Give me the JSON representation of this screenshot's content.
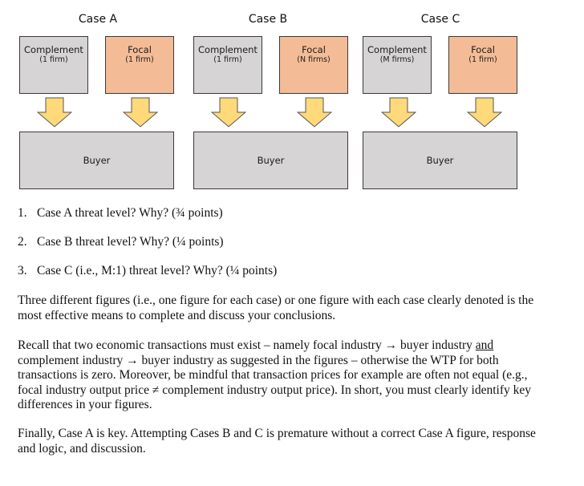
{
  "diagram": {
    "cases": [
      {
        "title": "Case A",
        "complement": {
          "label": "Complement",
          "firms": "(1 firm)"
        },
        "focal": {
          "label": "Focal",
          "firms": "(1 firm)"
        },
        "buyer": {
          "label": "Buyer"
        }
      },
      {
        "title": "Case B",
        "complement": {
          "label": "Complement",
          "firms": "(1 firm)"
        },
        "focal": {
          "label": "Focal",
          "firms": "(N firms)"
        },
        "buyer": {
          "label": "Buyer"
        }
      },
      {
        "title": "Case C",
        "complement": {
          "label": "Complement",
          "firms": "(M firms)"
        },
        "focal": {
          "label": "Focal",
          "firms": "(1 firm)"
        },
        "buyer": {
          "label": "Buyer"
        }
      }
    ],
    "colors": {
      "complement_fill": "#d6d4d5",
      "focal_fill": "#f4bc96",
      "buyer_fill": "#d6d4d5",
      "arrow_fill": "#ffd97a",
      "border": "#3a3a3a"
    }
  },
  "questions": [
    {
      "number": "1.",
      "text": "Case A threat level? Why? (¾ points)"
    },
    {
      "number": "2.",
      "text": "Case B threat level? Why? (¼ points)"
    },
    {
      "number": "3.",
      "text": "Case C (i.e., M:1) threat level? Why? (¼ points)"
    }
  ],
  "paragraphs": {
    "p1": "Three different figures (i.e., one figure for each case) or one figure with each case clearly denoted is the most effective means to complete and discuss your conclusions.",
    "p2_a": "Recall that two economic transactions must exist – namely focal industry → buyer industry ",
    "p2_underlined": "and",
    "p2_b": " complement industry → buyer industry as suggested in the figures – otherwise the WTP for both transactions is zero. Moreover, be mindful that transaction prices for example are often not equal (e.g., focal industry output price ≠ complement industry output price). In short, you must clearly identify key differences in your figures.",
    "p3": "Finally, Case A is key. Attempting Cases B and C is premature without a correct Case A figure, response and logic, and discussion."
  }
}
